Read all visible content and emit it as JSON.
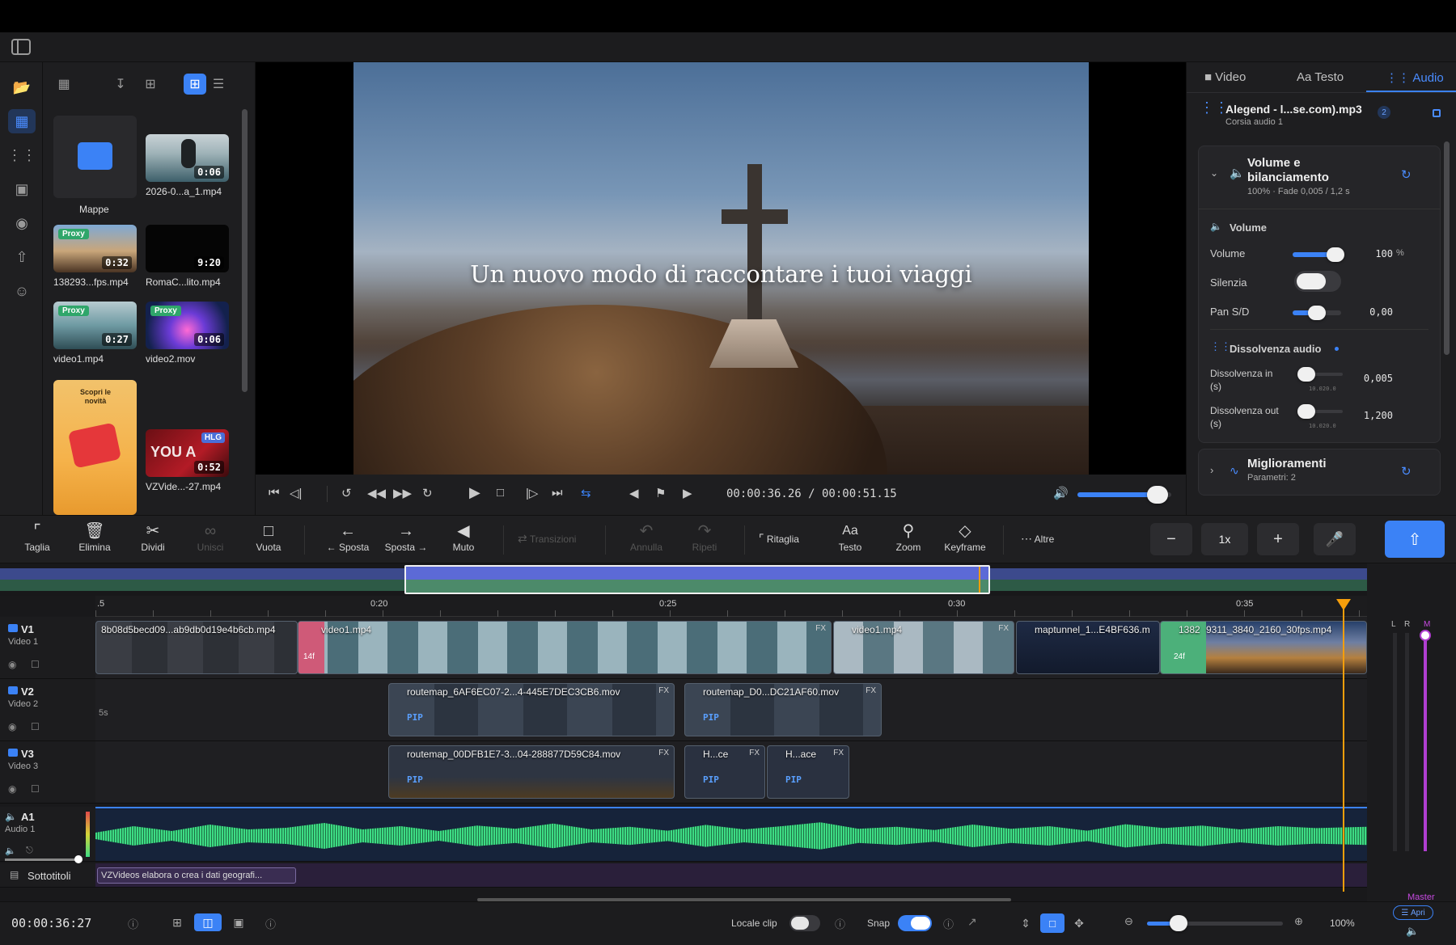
{
  "toggle_sidebar_icon": "sidebar-icon",
  "rail": {
    "items": [
      "folder-plus-icon",
      "film-icon",
      "waveform-icon",
      "image-icon",
      "palette-icon",
      "share-icon",
      "sticker-icon"
    ]
  },
  "media": {
    "items": [
      {
        "name": "Mappe",
        "kind": "folder"
      },
      {
        "name": "2026-0...a_1.mp4",
        "duration": "0:06"
      },
      {
        "name": "138293...fps.mp4",
        "duration": "0:32",
        "badge": "Proxy"
      },
      {
        "name": "RomaC...lito.mp4",
        "duration": "9:20"
      },
      {
        "name": "video1.mp4",
        "duration": "0:27",
        "badge": "Proxy"
      },
      {
        "name": "video2.mov",
        "duration": "0:06",
        "badge": "Proxy"
      },
      {
        "name": "",
        "promo_title": "Scopri le novità"
      },
      {
        "name": "VZVide...-27.mp4",
        "duration": "0:52",
        "badge": "HLG"
      }
    ]
  },
  "preview": {
    "caption": "Un nuovo modo di raccontare i tuoi viaggi"
  },
  "transport": {
    "timecode": "00:00:36.26 / 00:00:51.15",
    "volume": 0.85
  },
  "inspector": {
    "tabs": [
      {
        "label": "Video"
      },
      {
        "label": "Testo"
      },
      {
        "label": "Audio"
      }
    ],
    "active_tab": "Audio",
    "clip_name": "Alegend - l...se.com).mp3",
    "clip_track": "Corsia audio 1",
    "badge": "2",
    "volume_card": {
      "title_line1": "Volume e",
      "title_line2": "bilanciamento",
      "summary": "100% · Fade 0,005 / 1,2 s"
    },
    "volume_section": "Volume",
    "volume_label": "Volume",
    "volume_value": "100",
    "volume_unit": "%",
    "volume_level": 1.0,
    "mute_label": "Silenzia",
    "pan_label": "Pan S/D",
    "pan_value": "0,00",
    "pan_level": 0.5,
    "fade_section": "Dissolvenza audio",
    "fade_in_label": "Dissolvenza in",
    "fade_in_unit": "(s)",
    "fade_in_value": "0,005",
    "fade_in_level": 0.0,
    "fade_out_label": "Dissolvenza out",
    "fade_out_unit": "(s)",
    "fade_out_value": "1,200",
    "fade_out_level": 0.1,
    "range_hint": "10.020.0",
    "enh_title": "Miglioramenti",
    "enh_sub": "Parametri: 2"
  },
  "toolbar": {
    "items": [
      {
        "label": "Taglia",
        "icon": "crop-icon",
        "enabled": true
      },
      {
        "label": "Elimina",
        "icon": "trash-icon",
        "enabled": true
      },
      {
        "label": "Dividi",
        "icon": "scissors-icon",
        "enabled": true
      },
      {
        "label": "Unisci",
        "icon": "link-icon",
        "enabled": false
      },
      {
        "label": "Vuota",
        "icon": "empty-frame-icon",
        "enabled": true
      },
      {
        "label": "← Sposta",
        "icon": "arrow-left-icon",
        "enabled": true
      },
      {
        "label": "Sposta →",
        "icon": "arrow-right-icon",
        "enabled": true
      },
      {
        "label": "Muto",
        "icon": "mute-icon",
        "enabled": true
      },
      {
        "label": "Transizioni",
        "icon": "transition-icon",
        "enabled": false
      },
      {
        "label": "Annulla",
        "icon": "undo-icon",
        "enabled": false
      },
      {
        "label": "Ripeti",
        "icon": "redo-icon",
        "enabled": false
      },
      {
        "label": "Ritaglia",
        "icon": "crop-icon",
        "enabled": true
      },
      {
        "label": "Testo",
        "icon": "text-icon",
        "enabled": true
      },
      {
        "label": "Zoom",
        "icon": "zoom-icon",
        "enabled": true
      },
      {
        "label": "Keyframe",
        "icon": "diamond-icon",
        "enabled": true
      },
      {
        "label": "Altre",
        "icon": "more-icon",
        "enabled": true
      }
    ],
    "speed": "1x"
  },
  "ruler": {
    "ticks": [
      ".5",
      "0:20",
      "0:25",
      "0:30",
      "0:35"
    ]
  },
  "tracks": [
    {
      "id": "V1",
      "name": "Video 1"
    },
    {
      "id": "V2",
      "name": "Video 2"
    },
    {
      "id": "V3",
      "name": "Video 3"
    },
    {
      "id": "A1",
      "name": "Audio 1"
    },
    {
      "id": "",
      "name": "Sottotitoli"
    }
  ],
  "clips": {
    "v1": [
      "8b08d5becd09...ab9db0d19e4b6cb.mp4",
      "video1.mp4",
      "video1.mp4",
      "maptunnel_1...E4BF636.m",
      "1382",
      "9311_3840_2160_30fps.mp4"
    ],
    "v1_marks": [
      "14f",
      "24f"
    ],
    "v2": [
      "routemap_6AF6EC07-2...4-445E7DEC3CB6.mov",
      "routemap_D0...DC21AF60.mov"
    ],
    "v2_gap": "5s",
    "v3": [
      "routemap_00DFB1E7-3...04-288877D59C84.mov",
      "H...ce",
      "H...ace"
    ],
    "pip_label": "PIP",
    "fx_label": "FX",
    "subtitle": "VZVideos elabora o crea i dati geografi..."
  },
  "mixer": {
    "l": "L",
    "r": "R",
    "m": "M",
    "master": "Master",
    "apri": "Apri"
  },
  "status": {
    "timecode": "00:00:36:27",
    "local_clip": "Locale clip",
    "snap": "Snap",
    "snap_on": true,
    "zoom": "100%"
  }
}
